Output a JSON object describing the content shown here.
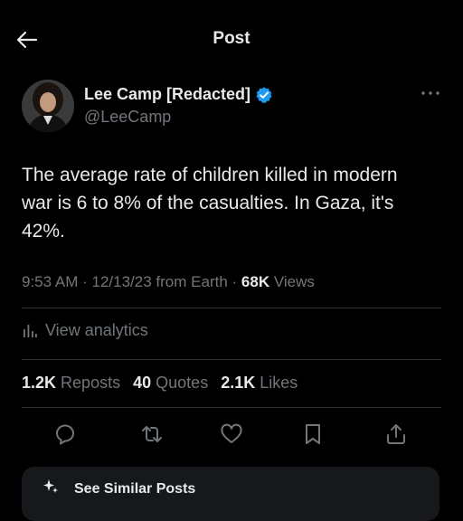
{
  "header": {
    "title": "Post",
    "back_icon": "arrow-left-icon"
  },
  "author": {
    "display_name": "Lee Camp [Redacted]",
    "handle": "@LeeCamp",
    "verified_badge_color": "#1d9bf0"
  },
  "tweet": {
    "text": "The average rate of children killed in modern\nwar is 6 to 8% of the casualties. In Gaza, it's\n42%.",
    "time": "9:53 AM",
    "date": "12/13/23",
    "source": "from Earth",
    "views_count": "68K",
    "views_label": "Views"
  },
  "analytics": {
    "label": "View analytics"
  },
  "stats": {
    "reposts_count": "1.2K",
    "reposts_label": "Reposts",
    "quotes_count": "40",
    "quotes_label": "Quotes",
    "likes_count": "2.1K",
    "likes_label": "Likes"
  },
  "actions": [
    "reply-icon",
    "repost-icon",
    "like-icon",
    "bookmark-icon",
    "share-icon"
  ],
  "bottom_card": {
    "label": "See Similar Posts",
    "icon": "sparkle-icon"
  },
  "colors": {
    "background": "#000000",
    "text_primary": "#e7e9ea",
    "text_secondary": "#71767b",
    "divider": "#2f3336",
    "accent": "#1d9bf0"
  }
}
